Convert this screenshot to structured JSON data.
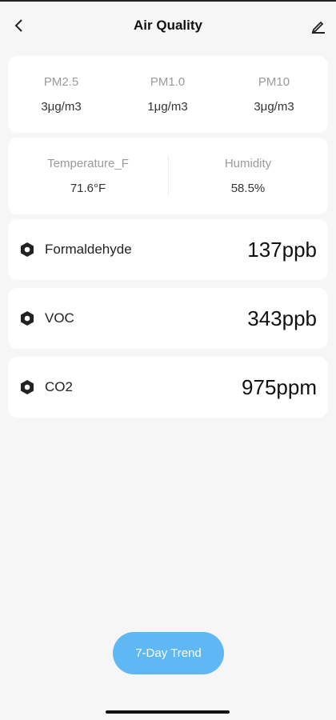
{
  "header": {
    "title": "Air Quality",
    "back_icon": "chevron-left-icon",
    "edit_icon": "pencil-icon"
  },
  "particulates": [
    {
      "label": "PM2.5",
      "value": "3μg/m3"
    },
    {
      "label": "PM1.0",
      "value": "1μg/m3"
    },
    {
      "label": "PM10",
      "value": "3μg/m3"
    }
  ],
  "environment": [
    {
      "label": "Temperature_F",
      "value": "71.6°F"
    },
    {
      "label": "Humidity",
      "value": "58.5%"
    }
  ],
  "metrics": [
    {
      "name": "Formaldehyde",
      "value": "137ppb",
      "icon": "hex-nut-icon"
    },
    {
      "name": "VOC",
      "value": "343ppb",
      "icon": "hex-nut-icon"
    },
    {
      "name": "CO2",
      "value": "975ppm",
      "icon": "hex-nut-icon"
    }
  ],
  "trend_button": {
    "label": "7-Day Trend"
  },
  "colors": {
    "accent": "#5fb8f3",
    "background": "#f6f6f6",
    "card": "#ffffff"
  }
}
